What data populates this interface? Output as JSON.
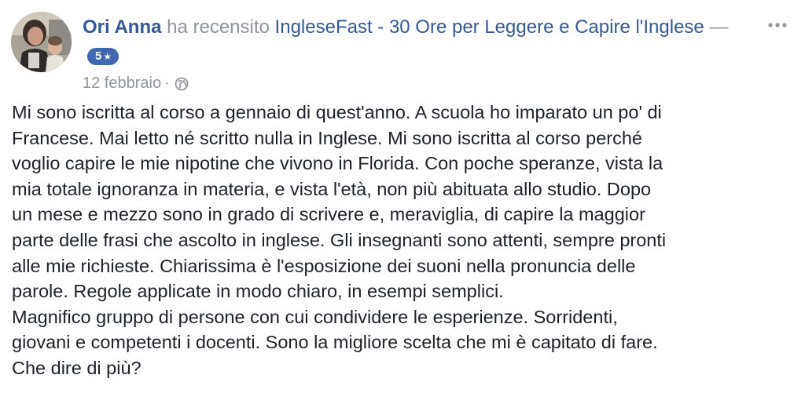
{
  "post": {
    "author": "Ori Anna",
    "verb": "ha recensito",
    "page_name": "IngleseFast - 30 Ore per Leggere e Capire l'Inglese",
    "dash": "—",
    "rating": "5",
    "rating_icon": "star-icon",
    "date": "12 febbraio",
    "meta_separator": "·",
    "audience_icon": "globe-icon",
    "more_icon": "more-options-icon",
    "review_text": "Mi sono iscritta al corso a gennaio di quest'anno. A scuola ho imparato un po' di\nFrancese. Mai letto né scritto nulla in Inglese. Mi sono iscritta al corso perché\nvoglio capire le mie nipotine che vivono in Florida. Con poche speranze, vista la\nmia totale ignoranza in materia, e vista l'età, non più abituata allo studio. Dopo\nun mese e mezzo sono in grado di scrivere e, meraviglia, di capire la maggior\nparte delle frasi che ascolto in inglese. Gli insegnanti sono attenti, sempre pronti\nalle mie richieste. Chiarissima è l'esposizione dei suoni nella pronuncia delle\nparole. Regole applicate in modo chiaro, in esempi semplici.\nMagnifico gruppo di persone con cui condividere le esperienze. Sorridenti,\ngiovani e competenti i docenti. Sono la migliore scelta che mi è capitato di fare.\nChe dire di più?"
  },
  "colors": {
    "link": "#365899",
    "secondary_text": "#90949c",
    "badge": "#4267b2",
    "body_text": "#1d2129"
  }
}
